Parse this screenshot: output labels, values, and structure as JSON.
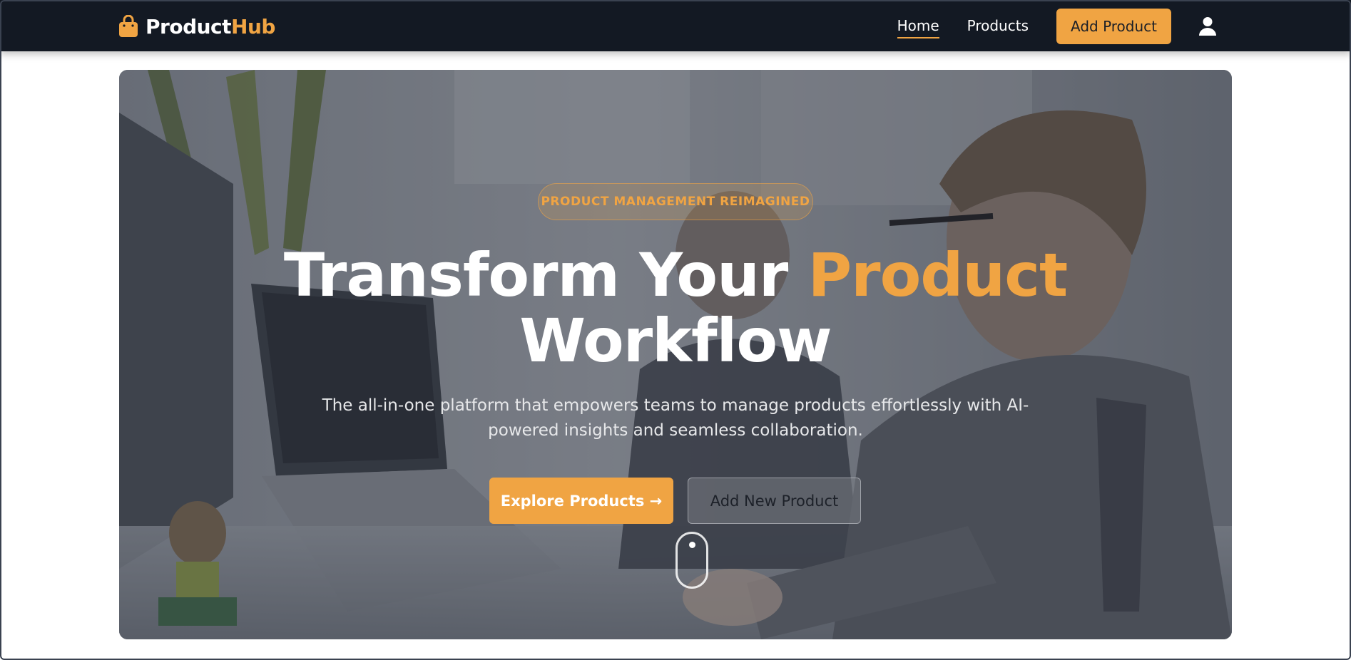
{
  "navbar": {
    "brand": {
      "part1": "Product",
      "part2": "Hub",
      "icon": "shopping-bag-icon"
    },
    "links": [
      {
        "label": "Home",
        "active": true
      },
      {
        "label": "Products",
        "active": false
      }
    ],
    "cta_label": "Add Product",
    "user_icon": "user-icon"
  },
  "hero": {
    "badge": "PRODUCT MANAGEMENT REIMAGINED",
    "headline": {
      "part1": "Transform Your ",
      "accent": "Product",
      "part2": "Workflow"
    },
    "subtitle": "The all-in-one platform that empowers teams to manage products effortlessly with AI-powered insights and seamless collaboration.",
    "primary_button": "Explore Products →",
    "secondary_button": "Add New Product",
    "scroll_icon": "mouse-scroll-icon"
  },
  "colors": {
    "navbar_bg": "#131923",
    "accent": "#f0a443",
    "white": "#ffffff"
  }
}
